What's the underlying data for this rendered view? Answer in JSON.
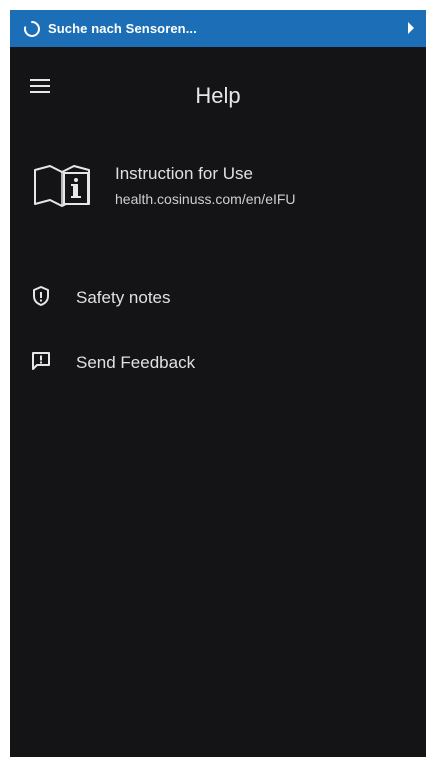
{
  "status_bar": {
    "text": "Suche nach Sensoren...",
    "spinner_icon": "loading-spinner-icon",
    "arrow_icon": "play-arrow-icon",
    "color": "#1c6fb6"
  },
  "header": {
    "title": "Help",
    "menu_icon": "hamburger-menu-icon"
  },
  "instruction": {
    "title": "Instruction for Use",
    "url": "health.cosinuss.com/en/eIFU",
    "icon": "manual-book-info-icon"
  },
  "menu_items": [
    {
      "label": "Safety notes",
      "icon": "shield-alert-icon"
    },
    {
      "label": "Send Feedback",
      "icon": "feedback-alert-icon"
    }
  ],
  "colors": {
    "background": "#141417",
    "text": "#e0e0e0"
  }
}
